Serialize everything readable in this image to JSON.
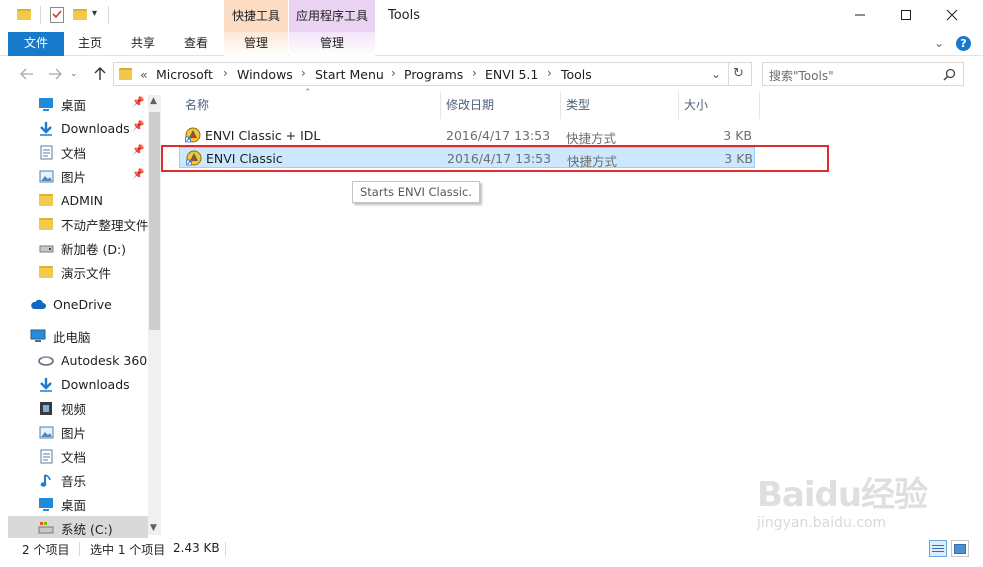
{
  "window": {
    "title": "Tools",
    "context_groups": [
      "快捷工具",
      "应用程序工具"
    ],
    "controls": {
      "minimize": "—",
      "maximize": "☐",
      "close": "✕"
    }
  },
  "ribbon": {
    "tabs": [
      "文件",
      "主页",
      "共享",
      "查看",
      "管理",
      "管理"
    ],
    "help": "?",
    "collapse": "⌄"
  },
  "address": {
    "overflow": "«",
    "breadcrumbs": [
      "Microsoft",
      "Windows",
      "Start Menu",
      "Programs",
      "ENVI 5.1",
      "Tools"
    ],
    "refresh": "↻",
    "dropdown": "⌄"
  },
  "search": {
    "placeholder": "搜索\"Tools\"",
    "icon": "search-icon"
  },
  "nav": {
    "quick_access": [
      {
        "label": "桌面",
        "icon": "desktop-icon",
        "pinned": true
      },
      {
        "label": "Downloads",
        "icon": "download-icon",
        "pinned": true
      },
      {
        "label": "文档",
        "icon": "document-icon",
        "pinned": true
      },
      {
        "label": "图片",
        "icon": "picture-icon",
        "pinned": true
      },
      {
        "label": "ADMIN",
        "icon": "folder-icon",
        "pinned": false
      },
      {
        "label": "不动产整理文件",
        "icon": "folder-icon",
        "pinned": false
      },
      {
        "label": "新加卷 (D:)",
        "icon": "drive-icon",
        "pinned": false
      },
      {
        "label": "演示文件",
        "icon": "folder-icon",
        "pinned": false
      }
    ],
    "onedrive": "OneDrive",
    "this_pc": "此电脑",
    "pc_items": [
      {
        "label": "Autodesk 360",
        "icon": "autodesk-icon"
      },
      {
        "label": "Downloads",
        "icon": "download-icon"
      },
      {
        "label": "视频",
        "icon": "video-icon"
      },
      {
        "label": "图片",
        "icon": "picture-icon"
      },
      {
        "label": "文档",
        "icon": "document-icon"
      },
      {
        "label": "音乐",
        "icon": "music-icon"
      },
      {
        "label": "桌面",
        "icon": "desktop-icon"
      },
      {
        "label": "系统 (C:)",
        "icon": "system-drive-icon"
      }
    ]
  },
  "columns": [
    "名称",
    "修改日期",
    "类型",
    "大小"
  ],
  "files": [
    {
      "name": "ENVI Classic + IDL",
      "date": "2016/4/17 13:53",
      "type": "快捷方式",
      "size": "3 KB",
      "selected": false
    },
    {
      "name": "ENVI Classic",
      "date": "2016/4/17 13:53",
      "type": "快捷方式",
      "size": "3 KB",
      "selected": true
    }
  ],
  "tooltip": "Starts ENVI Classic.",
  "status": {
    "count": "2 个项目",
    "selection": "选中 1 个项目",
    "size": "2.43 KB"
  },
  "watermark": {
    "main": "Baidu经验",
    "sub": "jingyan.baidu.com"
  },
  "colors": {
    "accent": "#1979ca",
    "selection": "#cce8ff",
    "highlight_box": "#e02b2b"
  }
}
